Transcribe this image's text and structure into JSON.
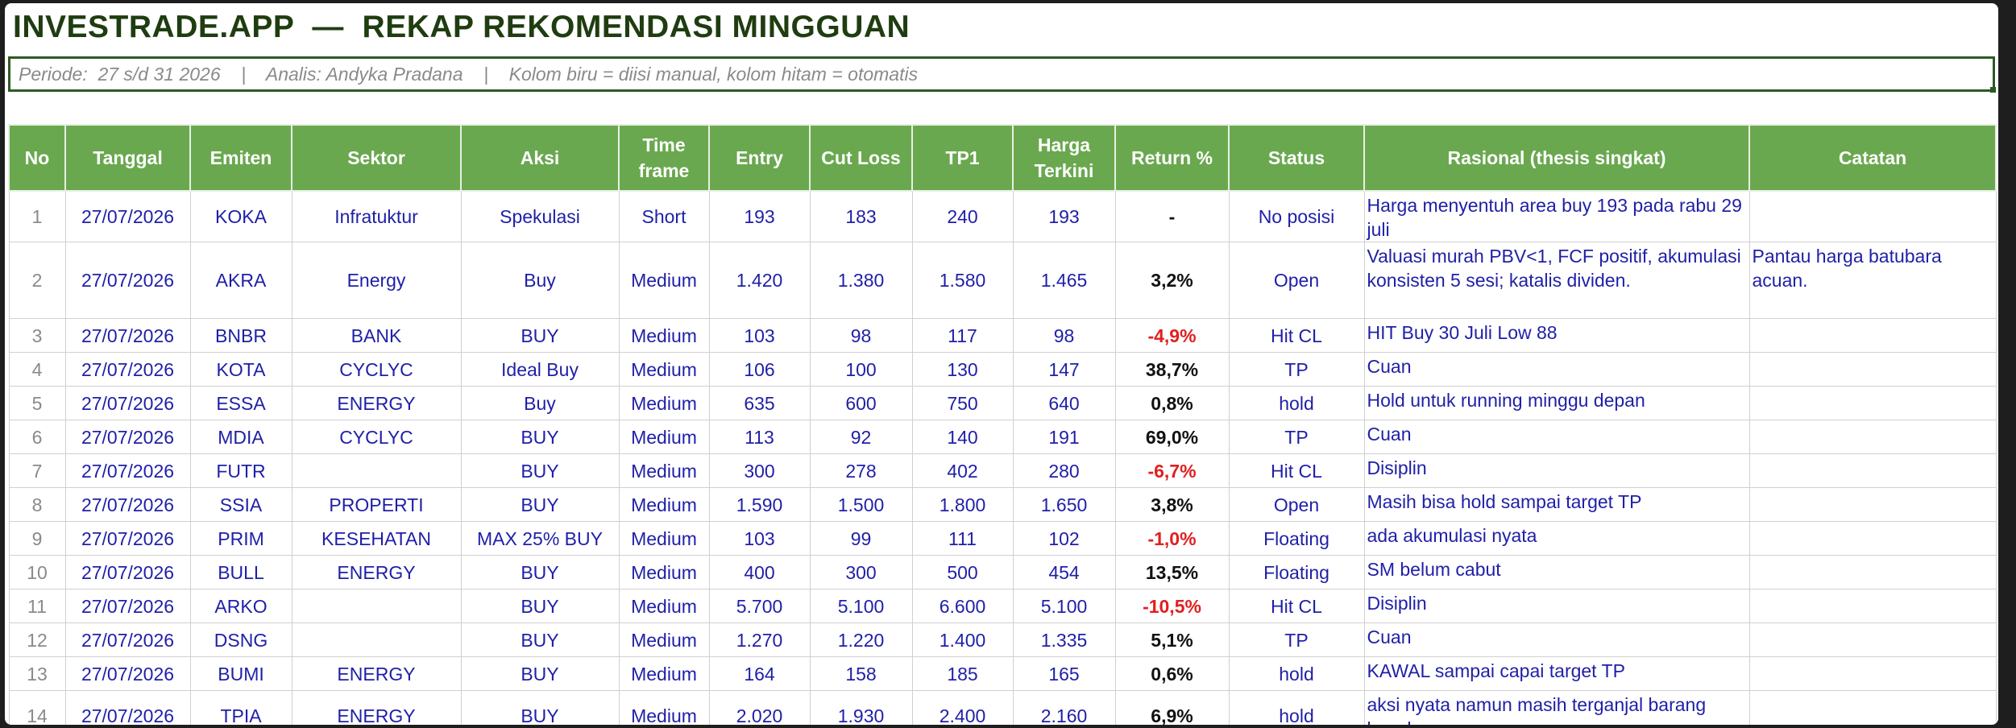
{
  "title": "INVESTRADE.APP  —  REKAP REKOMENDASI MINGGUAN",
  "info": "Periode:  27 s/d 31 2026    |    Analis: Andyka Pradana    |    Kolom biru = diisi manual, kolom hitam = otomatis",
  "headers": [
    "No",
    "Tanggal",
    "Emiten",
    "Sektor",
    "Aksi",
    "Time frame",
    "Entry",
    "Cut Loss",
    "TP1",
    "Harga Terkini",
    "Return %",
    "Status",
    "Rasional (thesis singkat)",
    "Catatan"
  ],
  "rows": [
    [
      "1",
      "27/07/2026",
      "KOKA",
      "Infratuktur",
      "Spekulasi",
      "Short",
      "193",
      "183",
      "240",
      "193",
      "-",
      "No posisi",
      "Harga menyentuh area buy 193 pada rabu 29 juli",
      ""
    ],
    [
      "2",
      "27/07/2026",
      "AKRA",
      "Energy",
      "Buy",
      "Medium",
      "1.420",
      "1.380",
      "1.580",
      "1.465",
      "3,2%",
      "Open",
      "Valuasi murah PBV<1, FCF positif, akumulasi konsisten 5 sesi; katalis dividen.",
      "Pantau harga batubara acuan."
    ],
    [
      "3",
      "27/07/2026",
      "BNBR",
      "BANK",
      "BUY",
      "Medium",
      "103",
      "98",
      "117",
      "98",
      "-4,9%",
      "Hit CL",
      "HIT Buy 30 Juli Low 88",
      ""
    ],
    [
      "4",
      "27/07/2026",
      "KOTA",
      "CYCLYC",
      "Ideal Buy",
      "Medium",
      "106",
      "100",
      "130",
      "147",
      "38,7%",
      "TP",
      "Cuan",
      ""
    ],
    [
      "5",
      "27/07/2026",
      "ESSA",
      "ENERGY",
      "Buy",
      "Medium",
      "635",
      "600",
      "750",
      "640",
      "0,8%",
      "hold",
      "Hold untuk running minggu depan",
      ""
    ],
    [
      "6",
      "27/07/2026",
      "MDIA",
      "CYCLYC",
      "BUY",
      "Medium",
      "113",
      "92",
      "140",
      "191",
      "69,0%",
      "TP",
      "Cuan",
      ""
    ],
    [
      "7",
      "27/07/2026",
      "FUTR",
      "",
      "BUY",
      "Medium",
      "300",
      "278",
      "402",
      "280",
      "-6,7%",
      "Hit CL",
      "Disiplin",
      ""
    ],
    [
      "8",
      "27/07/2026",
      "SSIA",
      "PROPERTI",
      "BUY",
      "Medium",
      "1.590",
      "1.500",
      "1.800",
      "1.650",
      "3,8%",
      "Open",
      "Masih bisa hold sampai target TP",
      ""
    ],
    [
      "9",
      "27/07/2026",
      "PRIM",
      "KESEHATAN",
      "MAX 25% BUY",
      "Medium",
      "103",
      "99",
      "111",
      "102",
      "-1,0%",
      "Floating",
      "ada akumulasi nyata",
      ""
    ],
    [
      "10",
      "27/07/2026",
      "BULL",
      "ENERGY",
      "BUY",
      "Medium",
      "400",
      "300",
      "500",
      "454",
      "13,5%",
      "Floating",
      "SM belum cabut",
      ""
    ],
    [
      "11",
      "27/07/2026",
      "ARKO",
      "",
      "BUY",
      "Medium",
      "5.700",
      "5.100",
      "6.600",
      "5.100",
      "-10,5%",
      "Hit CL",
      "Disiplin",
      ""
    ],
    [
      "12",
      "27/07/2026",
      "DSNG",
      "",
      "BUY",
      "Medium",
      "1.270",
      "1.220",
      "1.400",
      "1.335",
      "5,1%",
      "TP",
      "Cuan",
      ""
    ],
    [
      "13",
      "27/07/2026",
      "BUMI",
      "ENERGY",
      "BUY",
      "Medium",
      "164",
      "158",
      "185",
      "165",
      "0,6%",
      "hold",
      "KAWAL sampai capai target TP",
      ""
    ],
    [
      "14",
      "27/07/2026",
      "TPIA",
      "ENERGY",
      "BUY",
      "Medium",
      "2.020",
      "1.930",
      "2.400",
      "2.160",
      "6,9%",
      "hold",
      "aksi nyata namun masih terganjal barang basah",
      ""
    ]
  ]
}
